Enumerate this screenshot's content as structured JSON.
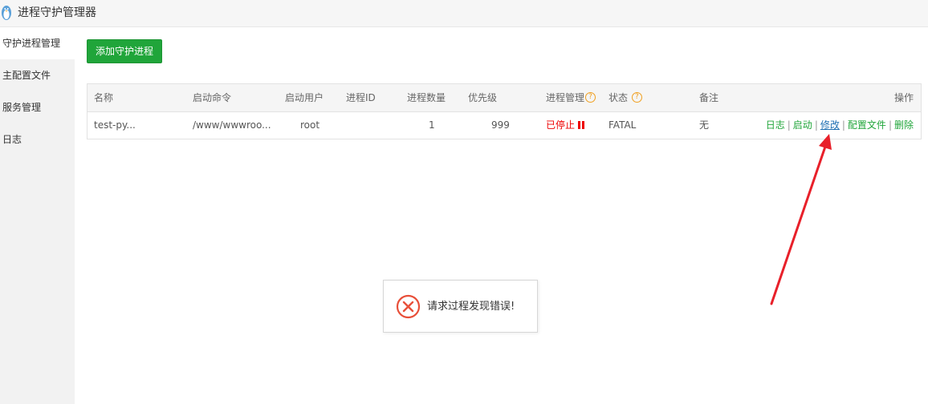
{
  "app": {
    "title": "进程守护管理器",
    "logo_icon": "penguin-icon"
  },
  "sidebar": {
    "items": [
      {
        "label": "守护进程管理",
        "active": true
      },
      {
        "label": "主配置文件",
        "active": false
      },
      {
        "label": "服务管理",
        "active": false
      },
      {
        "label": "日志",
        "active": false
      }
    ]
  },
  "toolbar": {
    "add_label": "添加守护进程"
  },
  "table": {
    "headers": {
      "name": "名称",
      "command": "启动命令",
      "user": "启动用户",
      "pid": "进程ID",
      "count": "进程数量",
      "priority": "优先级",
      "manage": "进程管理",
      "status": "状态",
      "remark": "备注",
      "ops": "操作"
    },
    "help_icon": "?",
    "rows": [
      {
        "name": "test-py...",
        "command": "/www/wwwroo...",
        "user": "root",
        "pid": "",
        "count": "1",
        "priority": "999",
        "manage": "已停止",
        "status": "FATAL",
        "remark": "无",
        "ops": {
          "log": "日志",
          "start": "启动",
          "edit": "修改",
          "config": "配置文件",
          "delete": "删除",
          "sep": "|"
        }
      }
    ]
  },
  "toast": {
    "message": "请求过程发现错误!",
    "icon": "error-circle-icon"
  },
  "colors": {
    "accent": "#20a53a",
    "danger": "#e00000",
    "warning": "#f0a020",
    "link": "#1f6fb2",
    "arrow": "#e8202a"
  }
}
